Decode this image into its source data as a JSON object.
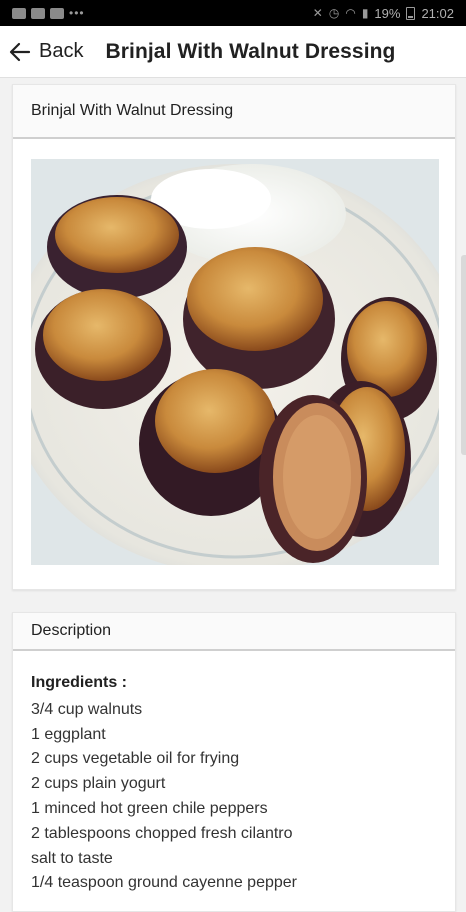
{
  "status_bar": {
    "time": "21:02",
    "battery": "19%"
  },
  "app_bar": {
    "back_label": "Back",
    "title": "Brinjal With Walnut Dressing"
  },
  "recipe_card": {
    "title": "Brinjal With Walnut Dressing",
    "image_alt": "Fried eggplant slices on a white plate with rice"
  },
  "description_card": {
    "heading": "Description",
    "ingredients_heading": "Ingredients :",
    "ingredients": [
      "3/4 cup walnuts",
      "1 eggplant",
      "2 cups vegetable oil for frying",
      "2 cups plain yogurt",
      "1 minced hot green chile peppers",
      "2 tablespoons chopped fresh cilantro",
      "salt to taste",
      "1/4 teaspoon ground cayenne pepper"
    ]
  }
}
